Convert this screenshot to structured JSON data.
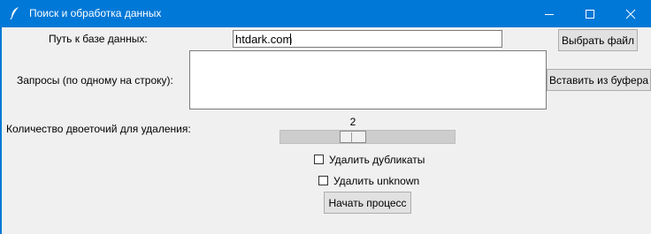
{
  "window": {
    "title": "Поиск и обработка данных"
  },
  "form": {
    "db_path_label": "Путь к базе данных:",
    "db_path_value": "htdark.com",
    "choose_file_label": "Выбрать файл",
    "queries_label": "Запросы (по одному на строку):",
    "queries_value": "",
    "paste_label": "Вставить из буфера",
    "colons_label": "Количество двоеточий для удаления:",
    "colons_value": "2",
    "remove_duplicates_label": "Удалить дубликаты",
    "remove_duplicates_checked": false,
    "remove_unknown_label": "Удалить unknown",
    "remove_unknown_checked": false,
    "start_label": "Начать процесс"
  }
}
